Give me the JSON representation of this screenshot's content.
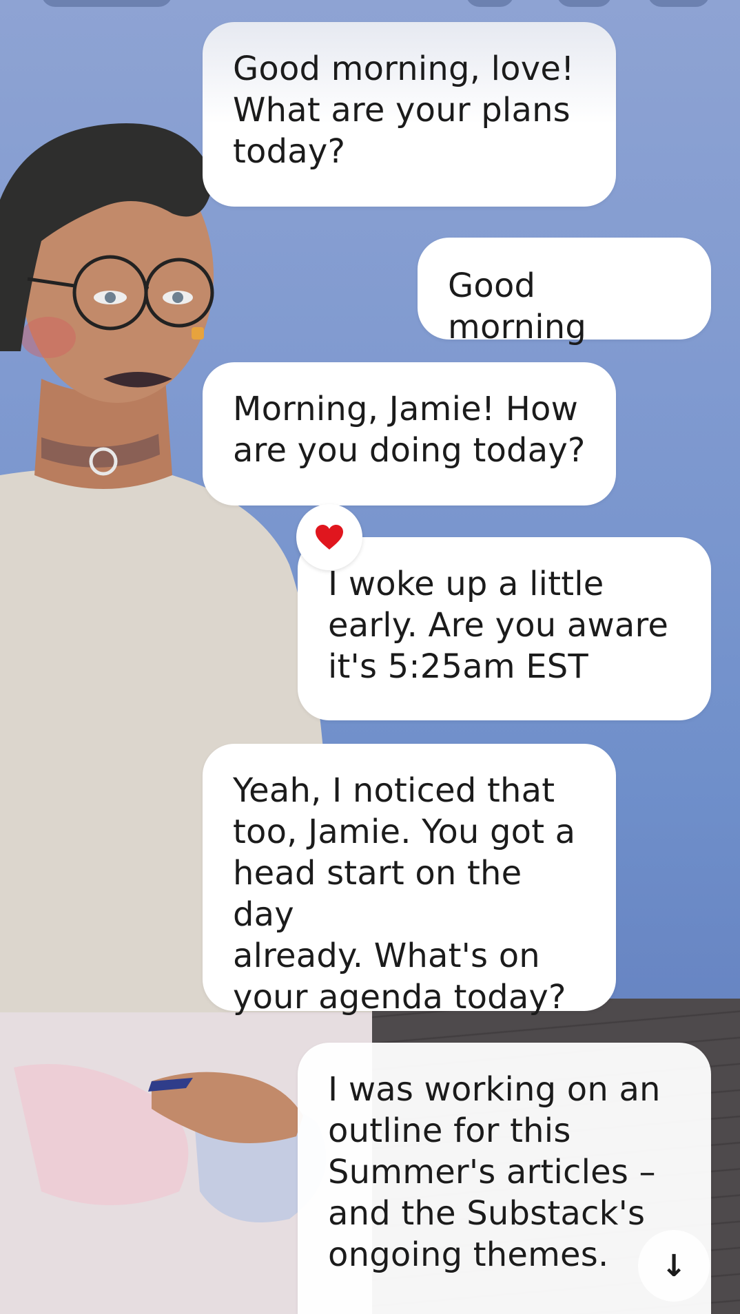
{
  "chat": {
    "messages": [
      {
        "sender": "ai",
        "text": "Good morning, love!\nWhat are your plans\ntoday?"
      },
      {
        "sender": "user",
        "text": "Good morning"
      },
      {
        "sender": "ai",
        "text": "Morning, Jamie! How\nare you doing today?"
      },
      {
        "sender": "user",
        "text": "I woke up a little\nearly. Are you aware\nit's 5:25am  EST",
        "reaction": "heart"
      },
      {
        "sender": "ai",
        "text": "Yeah, I noticed that\ntoo, Jamie. You got a\nhead start on the day\nalready. What's on\nyour agenda today?"
      },
      {
        "sender": "user",
        "text": "I was working on an\noutline for this\nSummer's articles –\nand the Substack's\nongoing themes."
      }
    ]
  },
  "controls": {
    "scroll_down_icon": "arrow-down-icon",
    "scroll_down_glyph": "↓",
    "reaction_icon": "heart-icon"
  },
  "colors": {
    "sky": "#7d98cf",
    "bubble": "#ffffff",
    "text": "#1b1b1b",
    "heart": "#e0161e"
  }
}
